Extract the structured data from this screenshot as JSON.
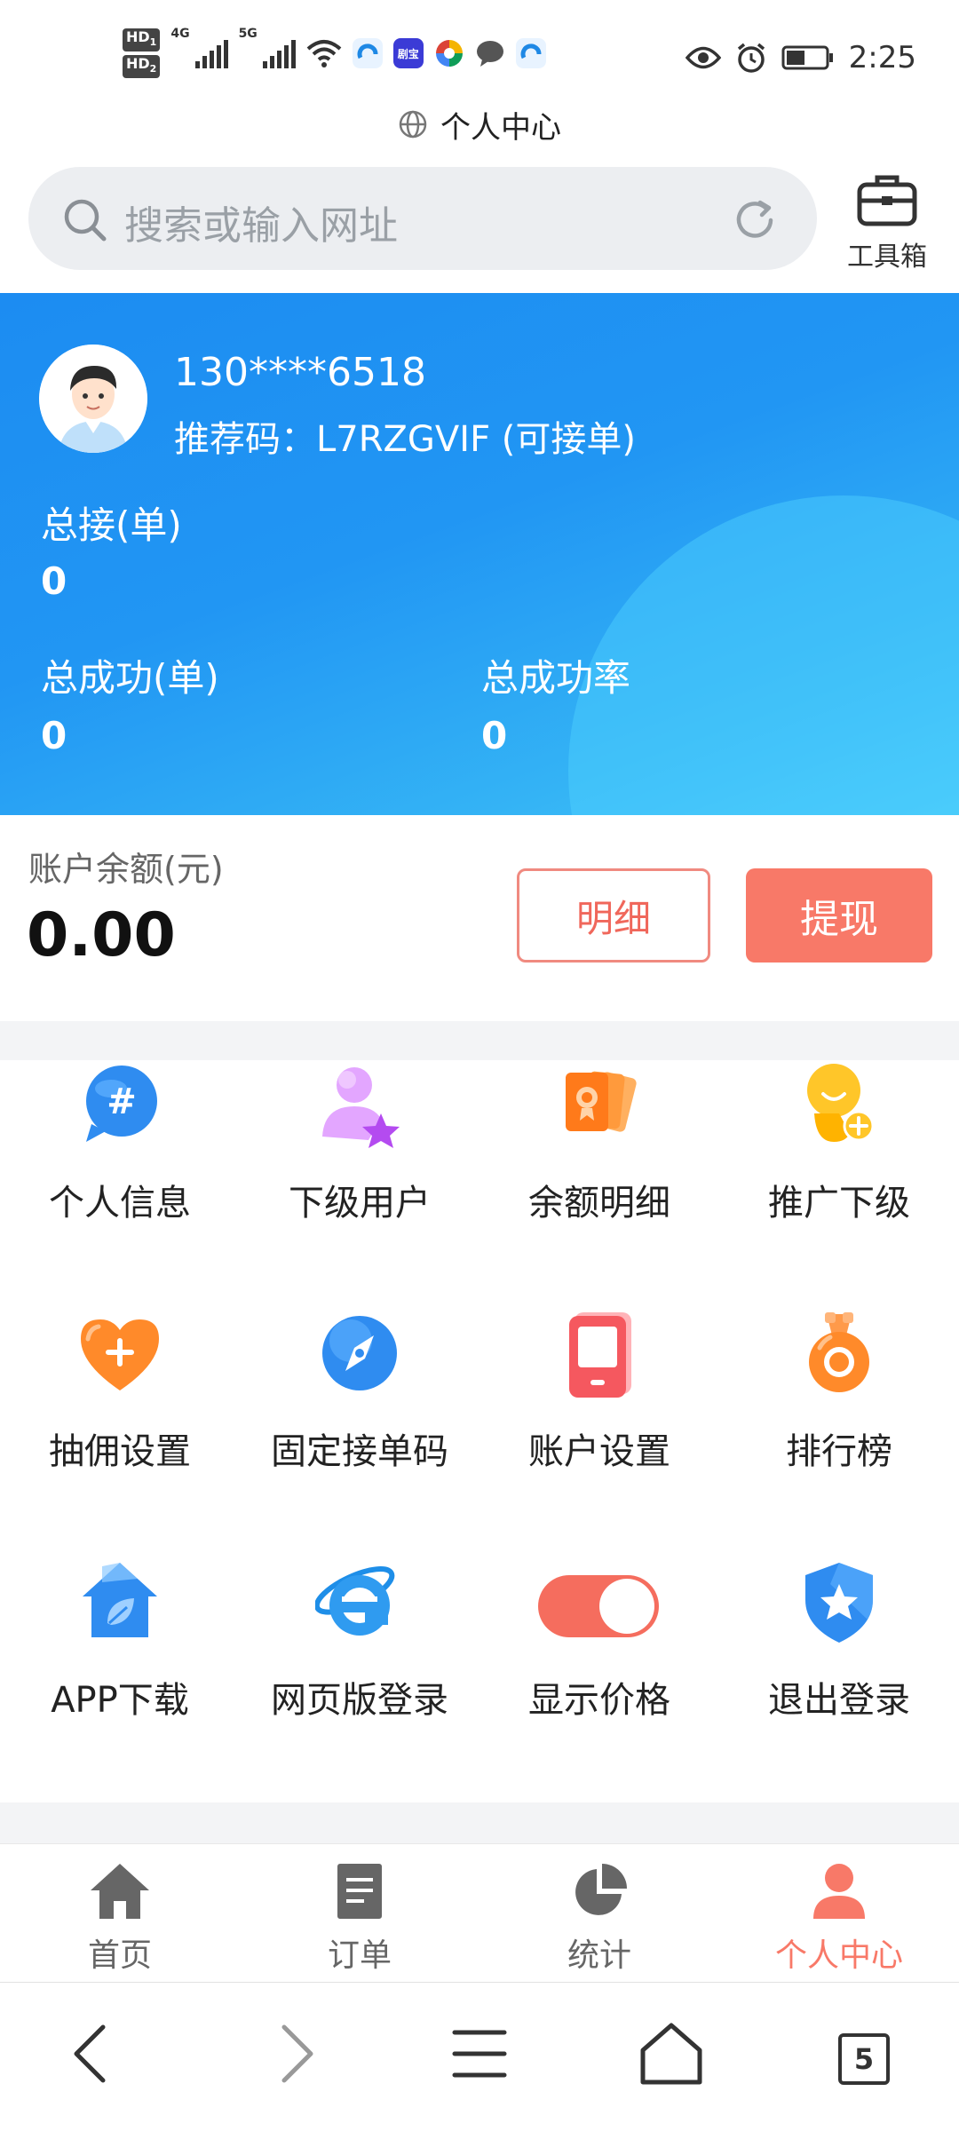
{
  "status_bar": {
    "hd1": "HD",
    "hd1_sub": "1",
    "hd2": "HD",
    "hd2_sub": "2",
    "net1": "4G",
    "net2": "5G",
    "app_badge": "剧宝",
    "time": "2:25",
    "icons": [
      "wifi-icon",
      "browser-app-icon",
      "app-icon",
      "pinwheel-app-icon",
      "chat-app-icon",
      "browser-app-icon",
      "eye-icon",
      "alarm-icon",
      "battery-icon"
    ]
  },
  "page_title": "个人中心",
  "search": {
    "placeholder": "搜索或输入网址"
  },
  "toolbox_label": "工具箱",
  "profile": {
    "phone": "130****6518",
    "referral": "推荐码：L7RZGVIF (可接单)",
    "total_received_label": "总接(单)",
    "total_received_value": "0",
    "total_success_label": "总成功(单)",
    "total_success_value": "0",
    "success_rate_label": "总成功率",
    "success_rate_value": "0"
  },
  "balance": {
    "label": "账户余额(元)",
    "value": "0.00",
    "detail_button": "明细",
    "withdraw_button": "提现"
  },
  "grid": [
    {
      "label": "个人信息",
      "icon": "hashtag-chat-icon"
    },
    {
      "label": "下级用户",
      "icon": "user-star-icon"
    },
    {
      "label": "余额明细",
      "icon": "cards-icon"
    },
    {
      "label": "推广下级",
      "icon": "user-add-icon"
    },
    {
      "label": "抽佣设置",
      "icon": "heart-plus-icon"
    },
    {
      "label": "固定接单码",
      "icon": "compass-icon"
    },
    {
      "label": "账户设置",
      "icon": "phone-icon"
    },
    {
      "label": "排行榜",
      "icon": "medal-icon"
    },
    {
      "label": "APP下载",
      "icon": "home-leaf-icon"
    },
    {
      "label": "网页版登录",
      "icon": "ie-browser-icon"
    },
    {
      "label": "显示价格",
      "icon": "toggle-icon",
      "toggle_on": true
    },
    {
      "label": "退出登录",
      "icon": "shield-star-icon"
    }
  ],
  "tabs": [
    {
      "label": "首页",
      "icon": "home-icon",
      "active": false
    },
    {
      "label": "订单",
      "icon": "document-icon",
      "active": false
    },
    {
      "label": "统计",
      "icon": "pie-chart-icon",
      "active": false
    },
    {
      "label": "个人中心",
      "icon": "person-icon",
      "active": true
    }
  ],
  "browser_nav": {
    "tab_count": "5"
  },
  "colors": {
    "accent": "#f87968",
    "header_blue": "#2196f3",
    "header_cyan": "#46c7f8"
  }
}
